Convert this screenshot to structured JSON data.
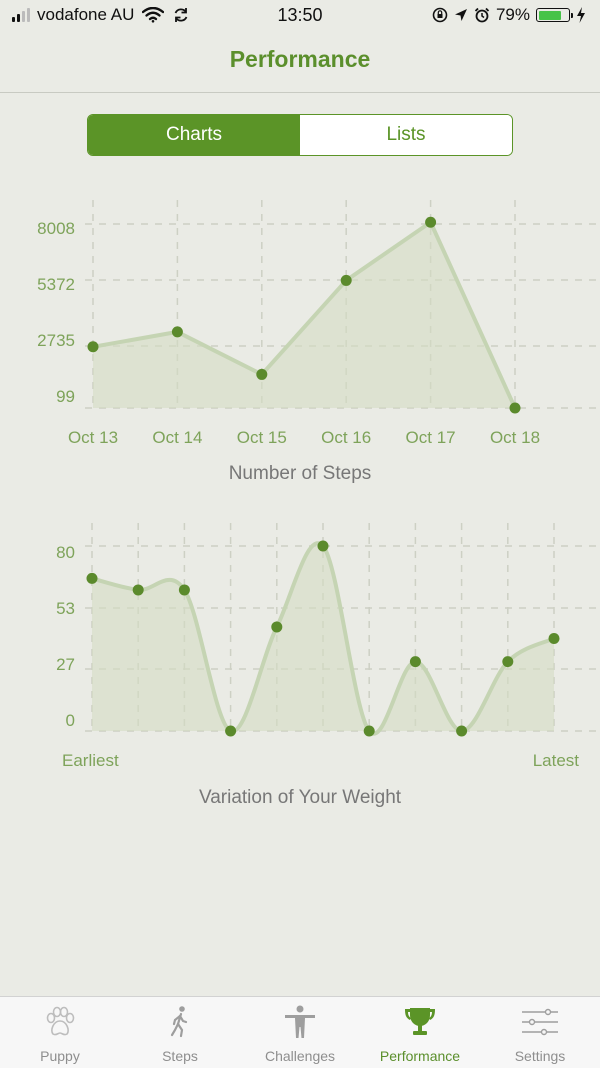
{
  "status_bar": {
    "carrier": "vodafone AU",
    "time": "13:50",
    "battery_percent": "79%",
    "battery_level": 0.79
  },
  "header": {
    "title": "Performance"
  },
  "segmented_control": {
    "options": [
      {
        "label": "Charts",
        "selected": true
      },
      {
        "label": "Lists",
        "selected": false
      }
    ]
  },
  "chart_data": [
    {
      "type": "line",
      "title": "Number of Steps",
      "categories": [
        "Oct 13",
        "Oct 14",
        "Oct 15",
        "Oct 16",
        "Oct 17",
        "Oct 18"
      ],
      "series": [
        {
          "values": [
            2735,
            3400,
            1500,
            5700,
            8300,
            0
          ]
        }
      ],
      "ytick_labels": [
        "8008",
        "5372",
        "2735",
        "99"
      ],
      "ylim": [
        0,
        8400
      ],
      "grid": true,
      "area_fill": true
    },
    {
      "type": "line",
      "title": "Variation of Your Weight",
      "x_labels": [
        "Earliest",
        "Latest"
      ],
      "series": [
        {
          "values": [
            66,
            61,
            61,
            0,
            45,
            80,
            0,
            30,
            0,
            30,
            40
          ]
        }
      ],
      "ytick_labels": [
        "80",
        "53",
        "27",
        "0"
      ],
      "ylim": [
        0,
        80
      ],
      "grid": true,
      "area_fill": true,
      "smooth": true
    }
  ],
  "tab_bar": {
    "items": [
      {
        "label": "Puppy",
        "icon": "paw-icon",
        "active": false
      },
      {
        "label": "Steps",
        "icon": "walking-icon",
        "active": false
      },
      {
        "label": "Challenges",
        "icon": "person-icon",
        "active": false
      },
      {
        "label": "Performance",
        "icon": "trophy-icon",
        "active": true
      },
      {
        "label": "Settings",
        "icon": "sliders-icon",
        "active": false
      }
    ]
  },
  "colors": {
    "accent": "#5b9427",
    "point": "#5b8a2c",
    "line": "#c5d4b3",
    "background": "#eaebe5"
  }
}
